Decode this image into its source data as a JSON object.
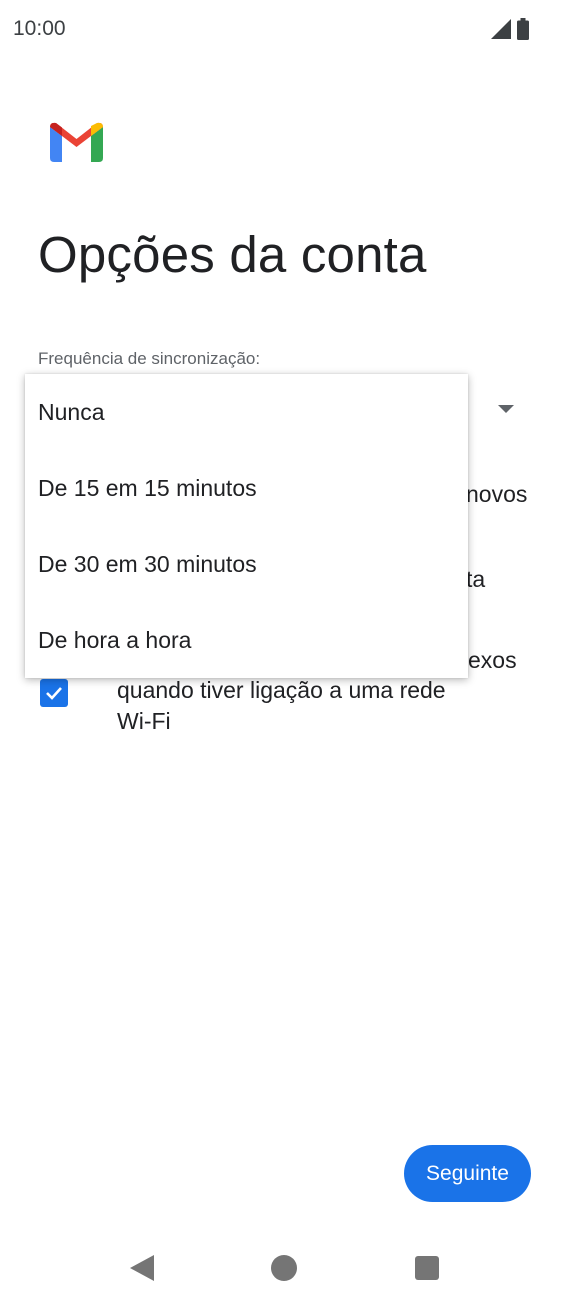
{
  "status_bar": {
    "time": "10:00",
    "icons": [
      "signal-icon",
      "battery-icon"
    ]
  },
  "app": {
    "logo": "gmail-logo-icon"
  },
  "page": {
    "title": "Opções da conta"
  },
  "sync": {
    "label": "Frequência de sincronização:"
  },
  "background_options": {
    "notify_partial": "novos",
    "sync_partial": "ta",
    "download_partial": "exos",
    "download_line2": "quando tiver ligação a uma rede",
    "download_line3": "Wi-Fi",
    "download_checked": true
  },
  "dropdown": {
    "options": [
      "Nunca",
      "De 15 em 15 minutos",
      "De 30 em 30 minutos",
      "De hora a hora"
    ]
  },
  "actions": {
    "next_label": "Seguinte"
  },
  "nav_bar": {
    "icons": [
      "back-icon",
      "home-icon",
      "recents-icon"
    ]
  },
  "colors": {
    "accent": "#1a73e8",
    "text": "#202124",
    "secondary_text": "#5f6368"
  }
}
